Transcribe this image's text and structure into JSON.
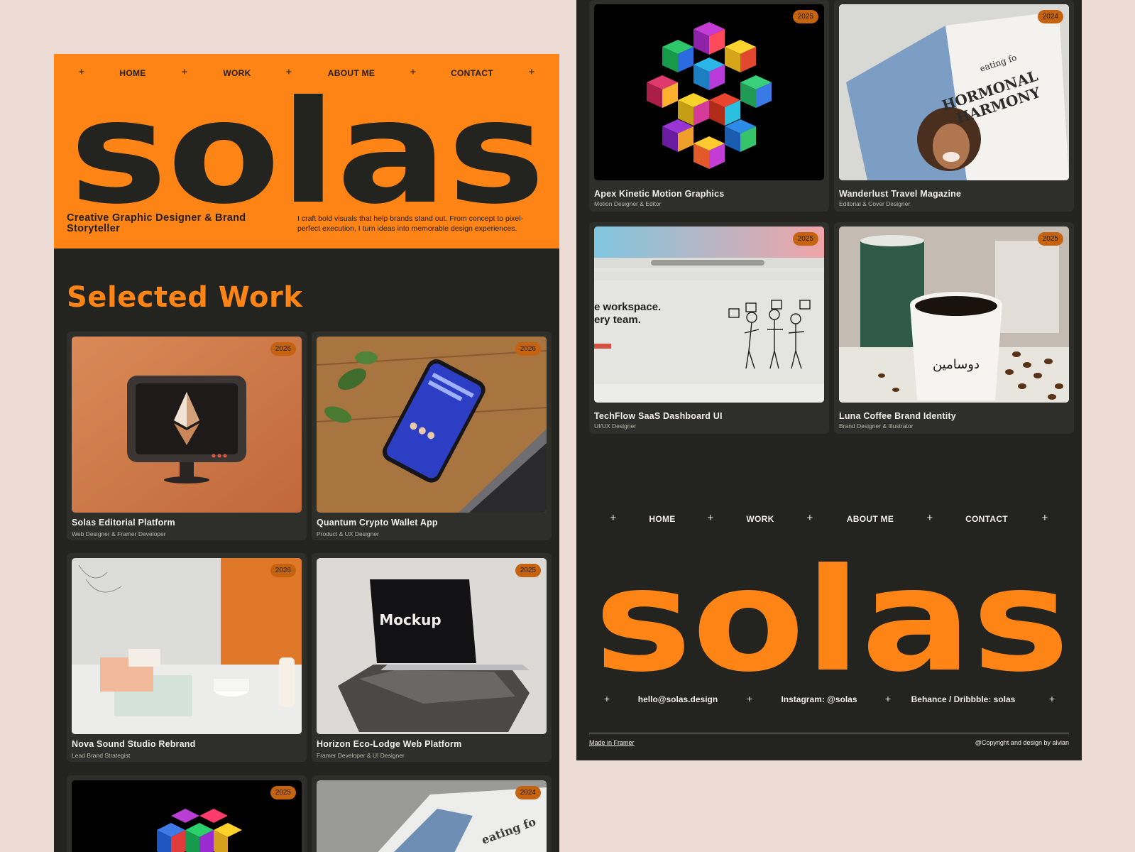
{
  "nav": {
    "plus": "+",
    "home": "HOME",
    "work": "WORK",
    "about": "ABOUT ME",
    "contact": "CONTACT"
  },
  "hero": {
    "logo_text": "solas",
    "tagline": "Creative Graphic Designer & Brand Storyteller",
    "description": "I craft bold visuals that help brands stand out. From concept to pixel-perfect execution, I turn ideas into memorable design experiences."
  },
  "section": {
    "title": "Selected Work"
  },
  "cards_left": [
    {
      "year": "2026",
      "title": "Solas Editorial Platform",
      "role": "Web Designer & Framer Developer"
    },
    {
      "year": "2026",
      "title": "Quantum Crypto Wallet App",
      "role": "Product & UX Designer"
    },
    {
      "year": "2026",
      "title": "Nova Sound Studio Rebrand",
      "role": "Lead Brand Strategist"
    },
    {
      "year": "2025",
      "title": "Horizon Eco-Lodge Web Platform",
      "role": "Framer Developer & UI Designer"
    },
    {
      "year": "2025",
      "title": "",
      "role": ""
    },
    {
      "year": "2024",
      "title": "",
      "role": ""
    }
  ],
  "cards_right": [
    {
      "year": "2025",
      "title": "Apex Kinetic Motion Graphics",
      "role": "Motion Designer & Editor"
    },
    {
      "year": "2024",
      "title": "Wanderlust Travel Magazine",
      "role": "Editorial & Cover Designer"
    },
    {
      "year": "2025",
      "title": "TechFlow SaaS Dashboard UI",
      "role": "UI/UX Designer"
    },
    {
      "year": "2025",
      "title": "Luna Coffee Brand Identity",
      "role": "Brand Designer & Illustrator"
    }
  ],
  "image_text": {
    "mockup": "Mockup",
    "workspace_line1": "e workspace.",
    "workspace_line2": "ery team.",
    "magazine_line1": "eating fo",
    "magazine_line2": "HORMONAL",
    "magazine_line3": "HARMONY",
    "cup_text": "دوسامين"
  },
  "footer": {
    "logo_text": "solas",
    "email": "hello@solas.design",
    "instagram": "Instagram: @solas",
    "behance": "Behance / Dribbble: solas",
    "made_in": "Made in Framer",
    "copyright": "@Copyright and design by alvian"
  },
  "colors": {
    "accent": "#fe8416",
    "background_dark": "#23231f",
    "card": "#2e2f2a",
    "page": "#ecdcd5",
    "badge": "#c56310"
  }
}
